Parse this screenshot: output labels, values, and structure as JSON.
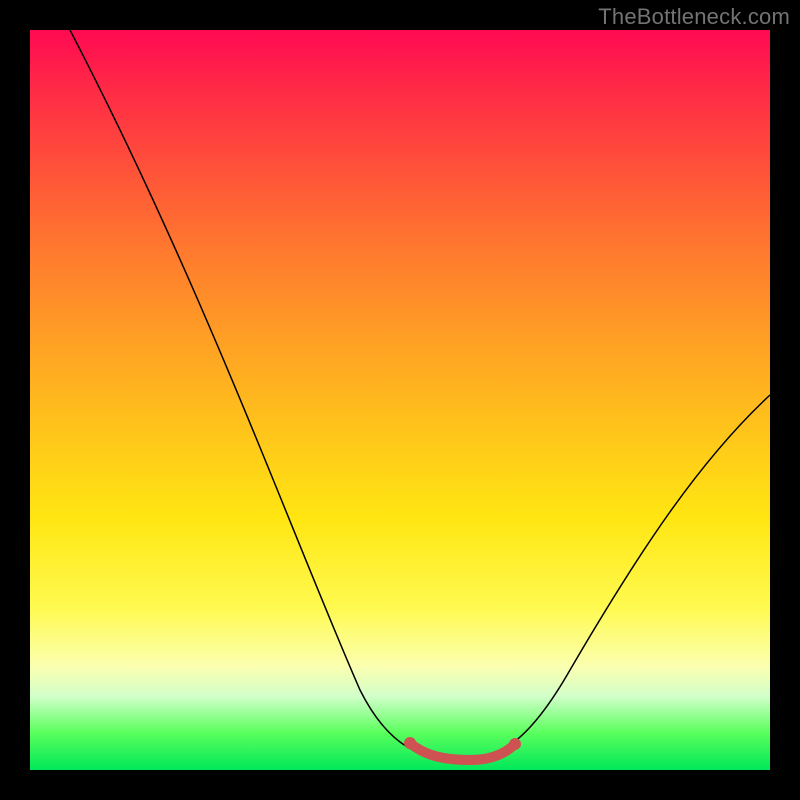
{
  "watermark": "TheBottleneck.com",
  "chart_data": {
    "type": "line",
    "title": "",
    "xlabel": "",
    "ylabel": "",
    "x": [
      0.0,
      0.05,
      0.1,
      0.15,
      0.2,
      0.25,
      0.3,
      0.35,
      0.4,
      0.45,
      0.5,
      0.55,
      0.6,
      0.65,
      0.7,
      0.75,
      0.8,
      0.85,
      0.9,
      0.95,
      1.0
    ],
    "series": [
      {
        "name": "curve",
        "values": [
          1.0,
          0.89,
          0.78,
          0.68,
          0.58,
          0.48,
          0.38,
          0.29,
          0.2,
          0.12,
          0.05,
          0.01,
          0.0,
          0.0,
          0.01,
          0.04,
          0.09,
          0.17,
          0.27,
          0.38,
          0.5
        ]
      }
    ],
    "highlight": {
      "x_range": [
        0.51,
        0.65
      ],
      "y": 0.0
    },
    "xlim": [
      0,
      1
    ],
    "ylim": [
      0,
      1
    ],
    "gradient_colors": {
      "top": "#ff0a52",
      "mid": "#ffe612",
      "bottom": "#00e85a"
    },
    "highlight_color": "#cf5252"
  }
}
